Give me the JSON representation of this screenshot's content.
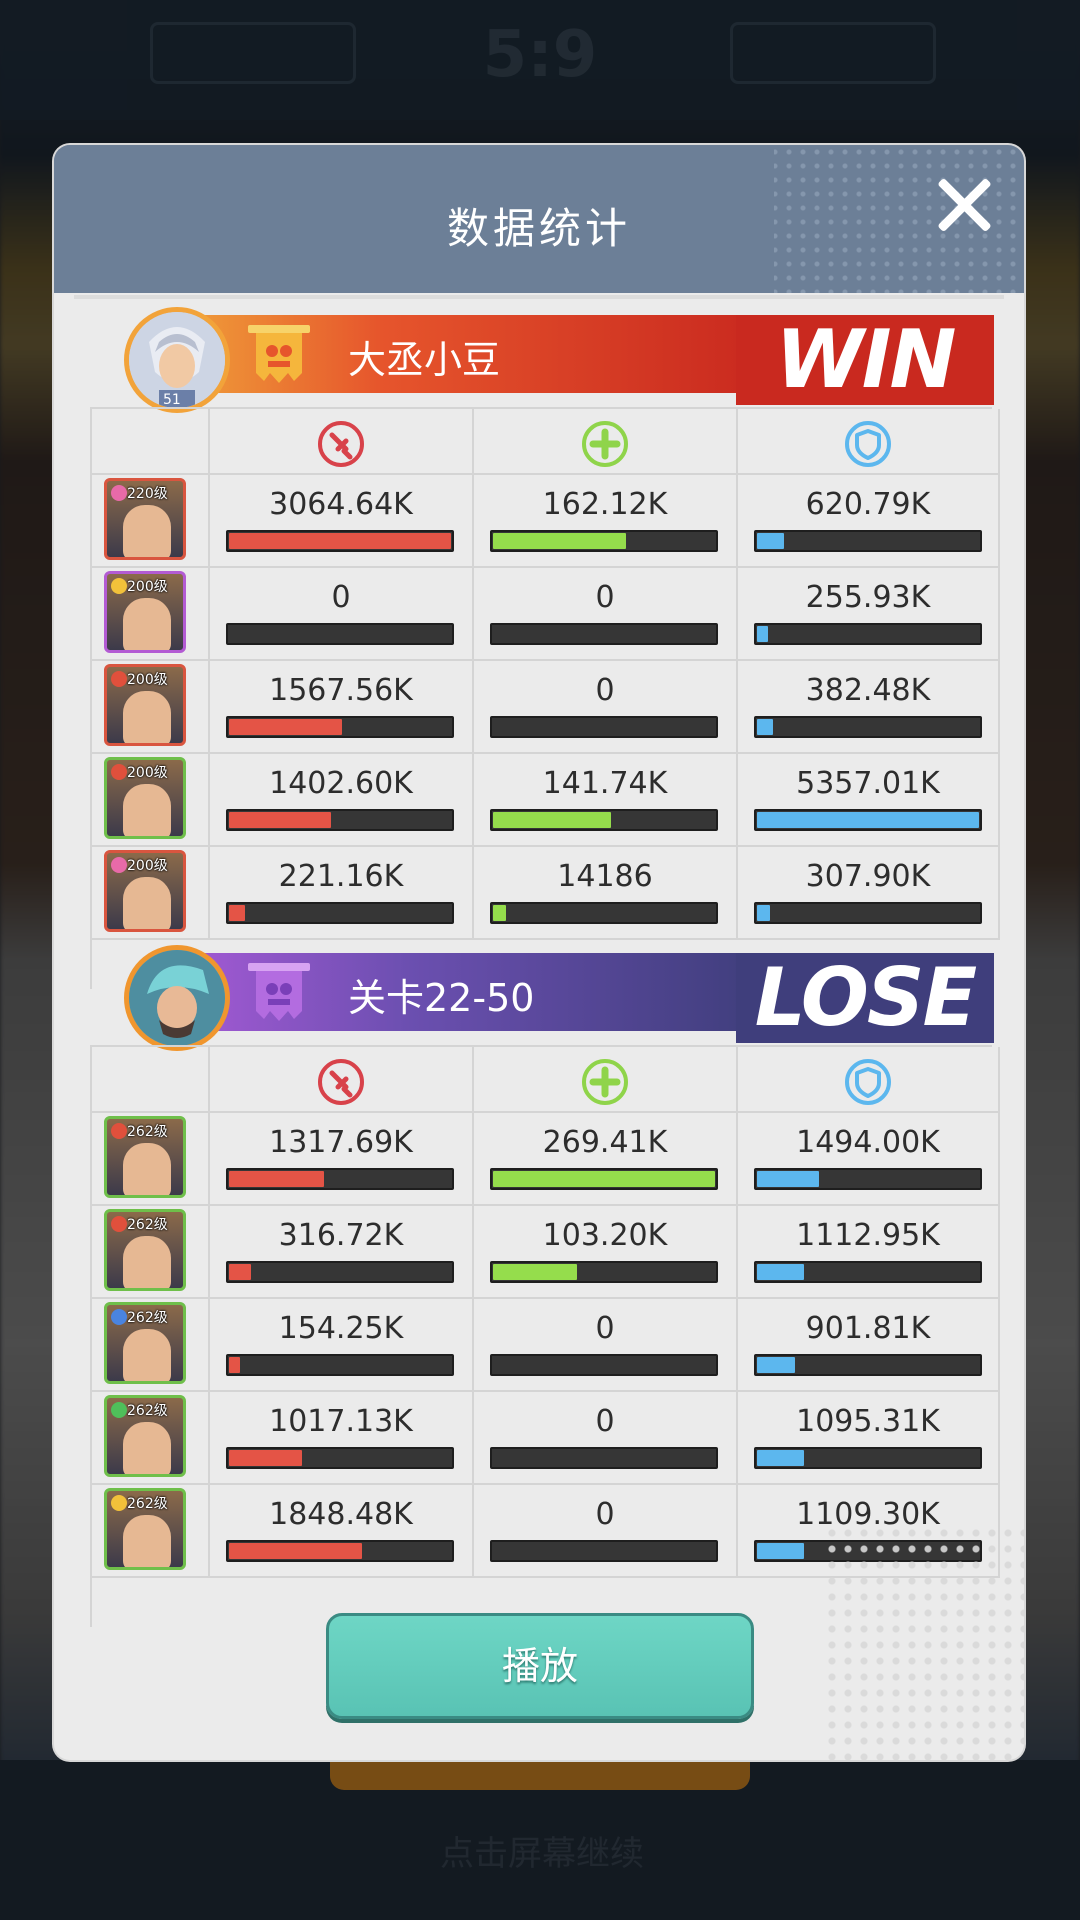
{
  "background": {
    "score": "5:9",
    "hint_text": "点击屏幕继续"
  },
  "dialog": {
    "title": "数据统计",
    "play_label": "播放"
  },
  "teams": [
    {
      "name": "大丞小豆",
      "result": "WIN",
      "avatar_level": "51",
      "heroes": [
        {
          "level": "220级",
          "dmg": "3064.64K",
          "dmg_frac": 1.0,
          "heal": "162.12K",
          "heal_frac": 0.6,
          "def": "620.79K",
          "def_frac": 0.12,
          "element_color": "#e86aa8",
          "frame_color": "#d9553f"
        },
        {
          "level": "200级",
          "dmg": "0",
          "dmg_frac": 0.0,
          "heal": "0",
          "heal_frac": 0.0,
          "def": "255.93K",
          "def_frac": 0.05,
          "element_color": "#f2c13a",
          "frame_color": "#b35bd3"
        },
        {
          "level": "200级",
          "dmg": "1567.56K",
          "dmg_frac": 0.51,
          "heal": "0",
          "heal_frac": 0.0,
          "def": "382.48K",
          "def_frac": 0.07,
          "element_color": "#e0503c",
          "frame_color": "#d9553f"
        },
        {
          "level": "200级",
          "dmg": "1402.60K",
          "dmg_frac": 0.46,
          "heal": "141.74K",
          "heal_frac": 0.53,
          "def": "5357.01K",
          "def_frac": 1.0,
          "element_color": "#e0503c",
          "frame_color": "#6fbf4a"
        },
        {
          "level": "200级",
          "dmg": "221.16K",
          "dmg_frac": 0.07,
          "heal": "14186",
          "heal_frac": 0.06,
          "def": "307.90K",
          "def_frac": 0.06,
          "element_color": "#e86aa8",
          "frame_color": "#d9553f"
        }
      ]
    },
    {
      "name": "关卡22-50",
      "result": "LOSE",
      "heroes": [
        {
          "level": "262级",
          "dmg": "1317.69K",
          "dmg_frac": 0.43,
          "heal": "269.41K",
          "heal_frac": 1.0,
          "def": "1494.00K",
          "def_frac": 0.28,
          "element_color": "#e0503c",
          "frame_color": "#6fbf4a"
        },
        {
          "level": "262级",
          "dmg": "316.72K",
          "dmg_frac": 0.1,
          "heal": "103.20K",
          "heal_frac": 0.38,
          "def": "1112.95K",
          "def_frac": 0.21,
          "element_color": "#e0503c",
          "frame_color": "#6fbf4a"
        },
        {
          "level": "262级",
          "dmg": "154.25K",
          "dmg_frac": 0.05,
          "heal": "0",
          "heal_frac": 0.0,
          "def": "901.81K",
          "def_frac": 0.17,
          "element_color": "#4a84e0",
          "frame_color": "#6fbf4a"
        },
        {
          "level": "262级",
          "dmg": "1017.13K",
          "dmg_frac": 0.33,
          "heal": "0",
          "heal_frac": 0.0,
          "def": "1095.31K",
          "def_frac": 0.21,
          "element_color": "#4fbf5a",
          "frame_color": "#6fbf4a"
        },
        {
          "level": "262级",
          "dmg": "1848.48K",
          "dmg_frac": 0.6,
          "heal": "0",
          "heal_frac": 0.0,
          "def": "1109.30K",
          "def_frac": 0.21,
          "element_color": "#f2c13a",
          "frame_color": "#6fbf4a"
        }
      ]
    }
  ],
  "icons": {
    "damage": "sword-icon",
    "heal": "plus-icon",
    "defense": "shield-icon"
  },
  "colors": {
    "damage": "#e45446",
    "heal": "#95dd4c",
    "defense": "#5cb7ee",
    "win": "#c9291f",
    "lose": "#3f3e7c",
    "play_button": "#62ccbc"
  }
}
